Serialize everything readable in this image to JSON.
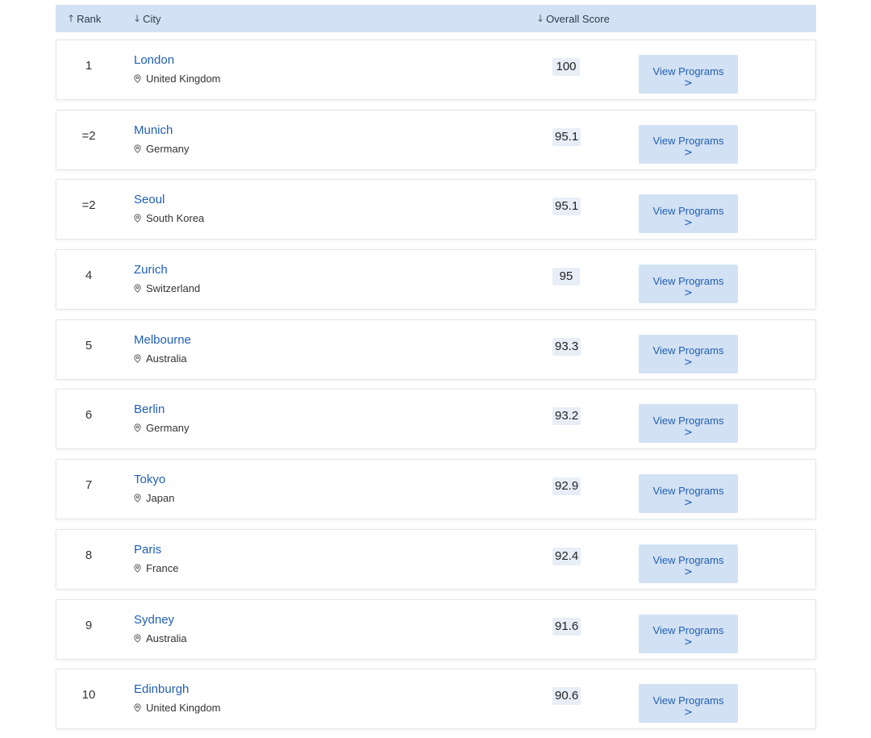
{
  "header": {
    "rank_label": "Rank",
    "rank_arrow": "↑",
    "city_label": "City",
    "city_arrow": "↓",
    "score_label": "Overall Score",
    "score_arrow": "↓"
  },
  "button": {
    "label": "View Programs",
    "chevron": ">"
  },
  "rows": [
    {
      "rank": "1",
      "city": "London",
      "country": "United Kingdom",
      "score": "100"
    },
    {
      "rank": "=2",
      "city": "Munich",
      "country": "Germany",
      "score": "95.1"
    },
    {
      "rank": "=2",
      "city": "Seoul",
      "country": "South Korea",
      "score": "95.1"
    },
    {
      "rank": "4",
      "city": "Zurich",
      "country": "Switzerland",
      "score": "95"
    },
    {
      "rank": "5",
      "city": "Melbourne",
      "country": "Australia",
      "score": "93.3"
    },
    {
      "rank": "6",
      "city": "Berlin",
      "country": "Germany",
      "score": "93.2"
    },
    {
      "rank": "7",
      "city": "Tokyo",
      "country": "Japan",
      "score": "92.9"
    },
    {
      "rank": "8",
      "city": "Paris",
      "country": "France",
      "score": "92.4"
    },
    {
      "rank": "9",
      "city": "Sydney",
      "country": "Australia",
      "score": "91.6"
    },
    {
      "rank": "10",
      "city": "Edinburgh",
      "country": "United Kingdom",
      "score": "90.6"
    }
  ],
  "colors": {
    "header_bg": "#d3e1f4",
    "link": "#1f5fb4",
    "button_bg": "#d3e1f4",
    "score_bg": "#e8eef7"
  },
  "icons": {
    "location": "location-pin-icon"
  }
}
